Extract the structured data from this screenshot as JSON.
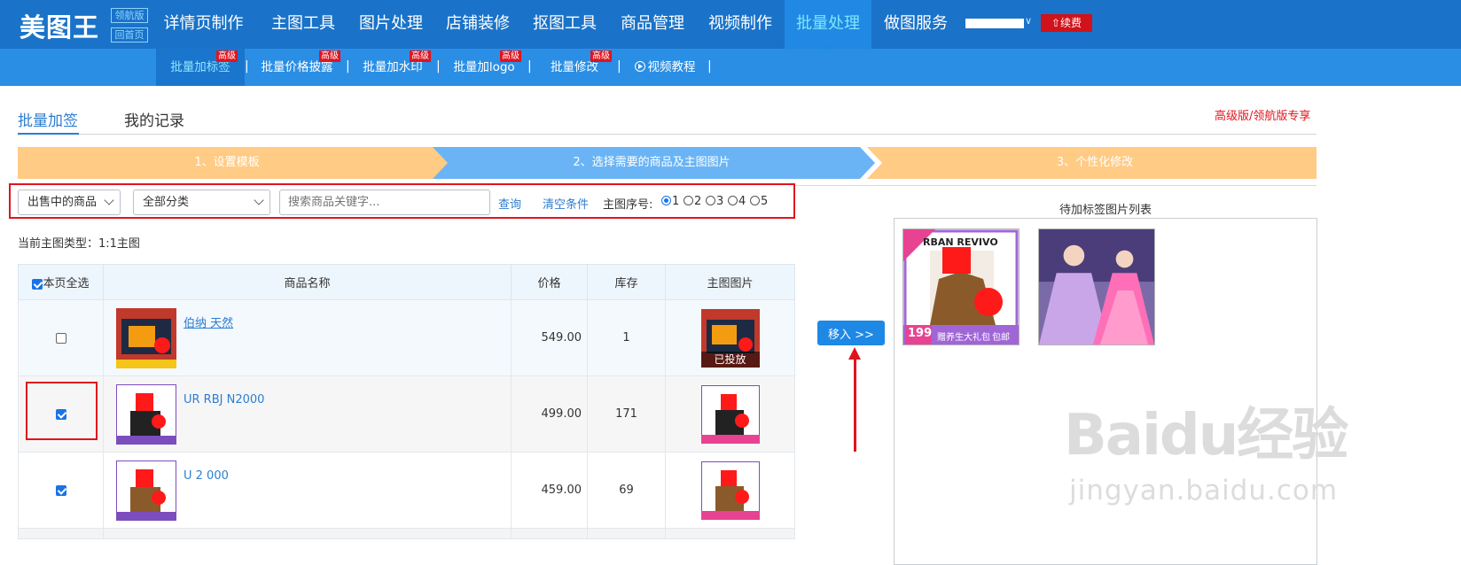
{
  "brand": {
    "logo": "美图王",
    "edition_top": "领航版",
    "edition_bottom": "回首页"
  },
  "topnav": {
    "items": [
      "详情页制作",
      "主图工具",
      "图片处理",
      "店铺装修",
      "抠图工具",
      "商品管理",
      "视频制作",
      "批量处理",
      "做图服务"
    ],
    "active": "批量处理",
    "renew_label": "续费"
  },
  "subnav": {
    "items": [
      "批量加标签",
      "批量价格披露",
      "批量加水印",
      "批量加logo",
      "批量修改",
      "视频教程"
    ],
    "badge": "高级",
    "active": "批量加标签"
  },
  "tabs": [
    "批量加签",
    "我的记录"
  ],
  "premium_note": "高级版/领航版专享",
  "steps": [
    "1、设置模板",
    "2、选择需要的商品及主图图片",
    "3、个性化修改"
  ],
  "filter": {
    "status_select": "出售中的商品",
    "category_select": "全部分类",
    "search_placeholder": "搜索商品关键字...",
    "query_label": "查询",
    "clear_label": "清空条件",
    "index_label": "主图序号:",
    "index_options": [
      "1",
      "2",
      "3",
      "4",
      "5"
    ],
    "index_selected": "1"
  },
  "main_type_label": "当前主图类型：1:1主图",
  "table": {
    "headers": [
      "本页全选",
      "商品名称",
      "价格",
      "库存",
      "主图图片"
    ],
    "rows": [
      {
        "checked": false,
        "name": "伯纳 天然",
        "price": "549.00",
        "stock": "1",
        "tag": "已投放"
      },
      {
        "checked": true,
        "name": "UR RBJ N2000",
        "price": "499.00",
        "stock": "171",
        "tag": ""
      },
      {
        "checked": true,
        "name": "U 2 000",
        "price": "459.00",
        "stock": "69",
        "tag": ""
      }
    ]
  },
  "move_label": "移入 >>",
  "pending": {
    "title": "待加标签图片列表",
    "thumb_brand": "RBAN REVIVO",
    "thumb_price": "199",
    "thumb_promo": "赠养生大礼包",
    "thumb_ship": "包邮"
  },
  "colors": {
    "nav": "#1a73c9",
    "subnav": "#2a8ee5",
    "accent": "#2d7ed0",
    "alert": "#e0141e",
    "step_done": "#ffcb85",
    "step_active": "#6ab4f5"
  },
  "watermark": {
    "main": "Baidu经验",
    "sub": "jingyan.baidu.com"
  }
}
